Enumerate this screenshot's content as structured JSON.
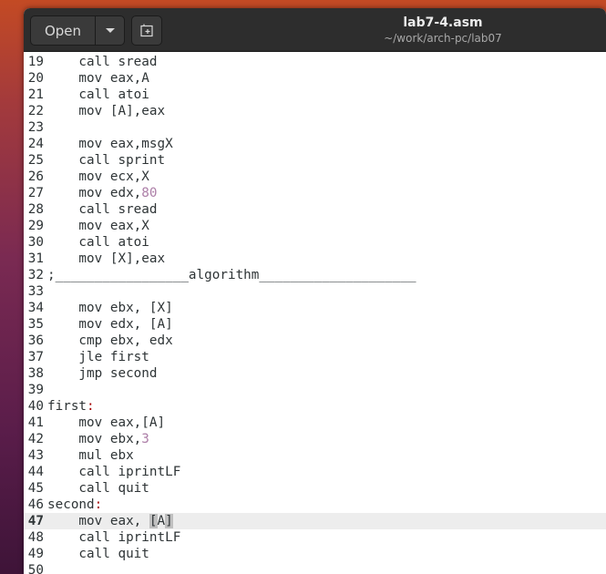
{
  "window": {
    "title": "lab7-4.asm",
    "subtitle": "~/work/arch-pc/lab07"
  },
  "header": {
    "open_label": "Open"
  },
  "icons": {
    "open_menu": "chevron-down-icon",
    "new_tab": "new-document-icon"
  },
  "colors": {
    "number_literal": "#ad7fa8",
    "label": "#a40000",
    "current_line_bg": "#ededed",
    "headerbar_bg": "#2d2d2d"
  },
  "editor": {
    "current_line": 47,
    "lines": [
      {
        "n": "19",
        "pre": "    call sread"
      },
      {
        "n": "20",
        "pre": "    mov eax,A"
      },
      {
        "n": "21",
        "pre": "    call atoi"
      },
      {
        "n": "22",
        "pre": "    mov [A],eax"
      },
      {
        "n": "23",
        "pre": ""
      },
      {
        "n": "24",
        "pre": "    mov eax,msgX"
      },
      {
        "n": "25",
        "pre": "    call sprint"
      },
      {
        "n": "26",
        "pre": "    mov ecx,X"
      },
      {
        "n": "27",
        "pre": "    mov edx,",
        "hl": "80"
      },
      {
        "n": "28",
        "pre": "    call sread"
      },
      {
        "n": "29",
        "pre": "    mov eax,X"
      },
      {
        "n": "30",
        "pre": "    call atoi"
      },
      {
        "n": "31",
        "pre": "    mov [X],eax"
      },
      {
        "n": "32",
        "pre": ";_________________algorithm____________________"
      },
      {
        "n": "33",
        "pre": ""
      },
      {
        "n": "34",
        "pre": "    mov ebx, [X]"
      },
      {
        "n": "35",
        "pre": "    mov edx, [A]"
      },
      {
        "n": "36",
        "pre": "    cmp ebx, edx"
      },
      {
        "n": "37",
        "pre": "    jle first"
      },
      {
        "n": "38",
        "pre": "    jmp second"
      },
      {
        "n": "39",
        "pre": ""
      },
      {
        "n": "40",
        "pre": "first",
        "label": ":"
      },
      {
        "n": "41",
        "pre": "    mov eax,[A]"
      },
      {
        "n": "42",
        "pre": "    mov ebx,",
        "hl": "3"
      },
      {
        "n": "43",
        "pre": "    mul ebx"
      },
      {
        "n": "44",
        "pre": "    call iprintLF"
      },
      {
        "n": "45",
        "pre": "    call quit"
      },
      {
        "n": "46",
        "pre": "second",
        "label": ":"
      },
      {
        "n": "47",
        "pre": "    mov eax, ",
        "sel": "[",
        "post": "A",
        "sel2": "]"
      },
      {
        "n": "48",
        "pre": "    call iprintLF"
      },
      {
        "n": "49",
        "pre": "    call quit"
      },
      {
        "n": "50",
        "pre": ""
      }
    ]
  }
}
